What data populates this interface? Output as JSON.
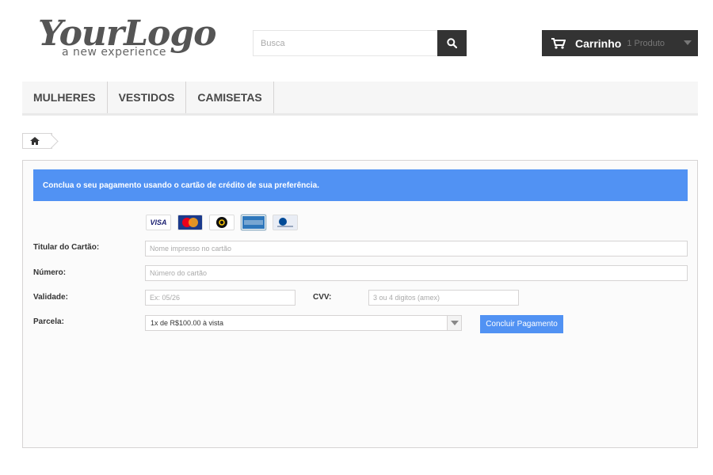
{
  "logo": {
    "main": "YourLogo",
    "tagline": "a new experience"
  },
  "search": {
    "placeholder": "Busca",
    "icon": "search-icon"
  },
  "cart": {
    "title": "Carrinho",
    "count": "1 Produto"
  },
  "nav": {
    "items": [
      {
        "label": "MULHERES"
      },
      {
        "label": "VESTIDOS"
      },
      {
        "label": "CAMISETAS"
      }
    ]
  },
  "breadcrumb": {
    "icon": "home-icon"
  },
  "payment": {
    "alert": "Conclua o seu pagamento usando o cartão de crédito de sua preferência.",
    "cards": [
      {
        "name": "visa",
        "text": "VISA"
      },
      {
        "name": "mastercard",
        "text": "MasterCard"
      },
      {
        "name": "elo",
        "text": "elo"
      },
      {
        "name": "amex",
        "text": "AMERICAN EXPRESS",
        "selected": true
      },
      {
        "name": "diners",
        "text": "Diners"
      }
    ],
    "holder": {
      "label": "Titular do Cartão:",
      "placeholder": "Nome impresso no cartão"
    },
    "number": {
      "label": "Número:",
      "placeholder": "Número do cartão"
    },
    "expiry": {
      "label": "Validade:",
      "placeholder": "Ex: 05/26"
    },
    "cvv": {
      "label": "CVV:",
      "placeholder": "3 ou 4 digitos (amex)"
    },
    "installments": {
      "label": "Parcela:",
      "value": "1x de R$100.00 à vista"
    },
    "submit_label": "Concluir Pagamento"
  },
  "colors": {
    "accent": "#5192f3",
    "dark": "#333333"
  }
}
